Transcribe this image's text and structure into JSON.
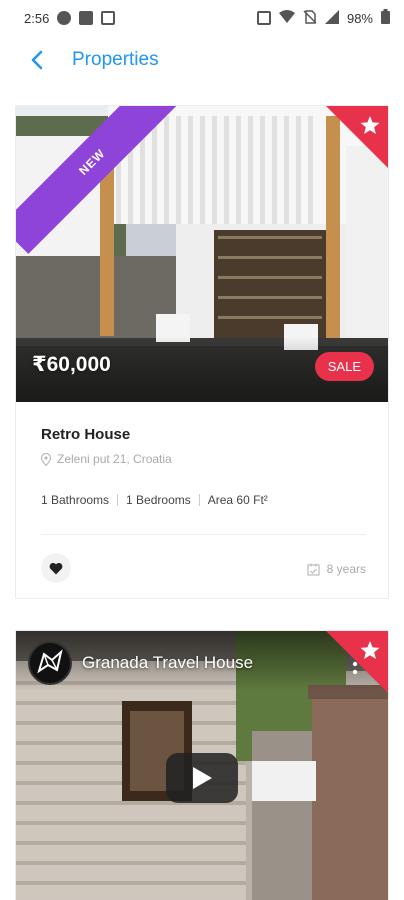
{
  "status_bar": {
    "time": "2:56",
    "battery": "98%"
  },
  "header": {
    "title": "Properties"
  },
  "colors": {
    "accent": "#2196f3",
    "sale": "#e8324b",
    "ribbon": "#8e44d9",
    "star_corner": "#e8324b"
  },
  "listings": [
    {
      "ribbon": "NEW",
      "price": "₹60,000",
      "badge": "SALE",
      "title": "Retro House",
      "address": "Zeleni put 21, Croatia",
      "features": [
        "1 Bathrooms",
        "1 Bedrooms",
        "Area 60 Ft²"
      ],
      "age": "8 years"
    },
    {
      "video_title": "Granada Travel House"
    }
  ]
}
